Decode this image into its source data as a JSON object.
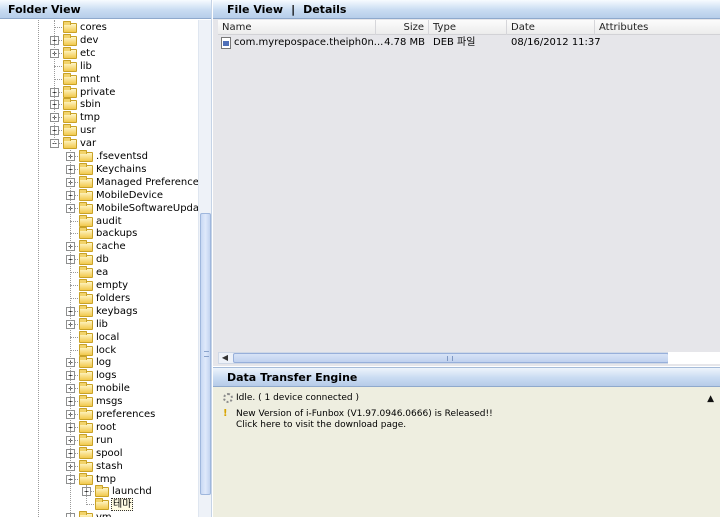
{
  "folder_view": {
    "title": "Folder View",
    "tree": [
      {
        "label": "cores",
        "depth": 0,
        "expander": "none"
      },
      {
        "label": "dev",
        "depth": 0,
        "expander": "+"
      },
      {
        "label": "etc",
        "depth": 0,
        "expander": "+"
      },
      {
        "label": "lib",
        "depth": 0,
        "expander": "none"
      },
      {
        "label": "mnt",
        "depth": 0,
        "expander": "none"
      },
      {
        "label": "private",
        "depth": 0,
        "expander": "+"
      },
      {
        "label": "sbin",
        "depth": 0,
        "expander": "+"
      },
      {
        "label": "tmp",
        "depth": 0,
        "expander": "+"
      },
      {
        "label": "usr",
        "depth": 0,
        "expander": "+"
      },
      {
        "label": "var",
        "depth": 0,
        "expander": "-"
      },
      {
        "label": ".fseventsd",
        "depth": 1,
        "expander": "+"
      },
      {
        "label": "Keychains",
        "depth": 1,
        "expander": "+"
      },
      {
        "label": "Managed Preferences",
        "depth": 1,
        "expander": "+"
      },
      {
        "label": "MobileDevice",
        "depth": 1,
        "expander": "+"
      },
      {
        "label": "MobileSoftwareUpdate",
        "depth": 1,
        "expander": "+"
      },
      {
        "label": "audit",
        "depth": 1,
        "expander": "none"
      },
      {
        "label": "backups",
        "depth": 1,
        "expander": "none"
      },
      {
        "label": "cache",
        "depth": 1,
        "expander": "+"
      },
      {
        "label": "db",
        "depth": 1,
        "expander": "+"
      },
      {
        "label": "ea",
        "depth": 1,
        "expander": "none"
      },
      {
        "label": "empty",
        "depth": 1,
        "expander": "none"
      },
      {
        "label": "folders",
        "depth": 1,
        "expander": "none"
      },
      {
        "label": "keybags",
        "depth": 1,
        "expander": "+"
      },
      {
        "label": "lib",
        "depth": 1,
        "expander": "+"
      },
      {
        "label": "local",
        "depth": 1,
        "expander": "none"
      },
      {
        "label": "lock",
        "depth": 1,
        "expander": "none"
      },
      {
        "label": "log",
        "depth": 1,
        "expander": "+"
      },
      {
        "label": "logs",
        "depth": 1,
        "expander": "+"
      },
      {
        "label": "mobile",
        "depth": 1,
        "expander": "+"
      },
      {
        "label": "msgs",
        "depth": 1,
        "expander": "+"
      },
      {
        "label": "preferences",
        "depth": 1,
        "expander": "+"
      },
      {
        "label": "root",
        "depth": 1,
        "expander": "+"
      },
      {
        "label": "run",
        "depth": 1,
        "expander": "+"
      },
      {
        "label": "spool",
        "depth": 1,
        "expander": "+"
      },
      {
        "label": "stash",
        "depth": 1,
        "expander": "+"
      },
      {
        "label": "tmp",
        "depth": 1,
        "expander": "-"
      },
      {
        "label": "launchd",
        "depth": 2,
        "expander": "+"
      },
      {
        "label": "테마",
        "depth": 2,
        "expander": "none",
        "selected": true
      },
      {
        "label": "vm",
        "depth": 1,
        "expander": "+"
      }
    ]
  },
  "file_view": {
    "title": "File View",
    "separator": "|",
    "mode": "Details",
    "columns": [
      "Name",
      "Size",
      "Type",
      "Date",
      "Attributes"
    ],
    "files": [
      {
        "name": "com.myrepospace.theiph0n...",
        "size": "4.78 MB",
        "type": "DEB 파일",
        "date": "08/16/2012  11:37",
        "attributes": ""
      }
    ]
  },
  "data_transfer_engine": {
    "title": "Data Transfer Engine",
    "status": "Idle. ( 1 device connected )",
    "notice_line1": "New Version of i-Funbox (V1.97.0946.0666) is Released!!",
    "notice_line2": "Click here to visit the download page."
  }
}
